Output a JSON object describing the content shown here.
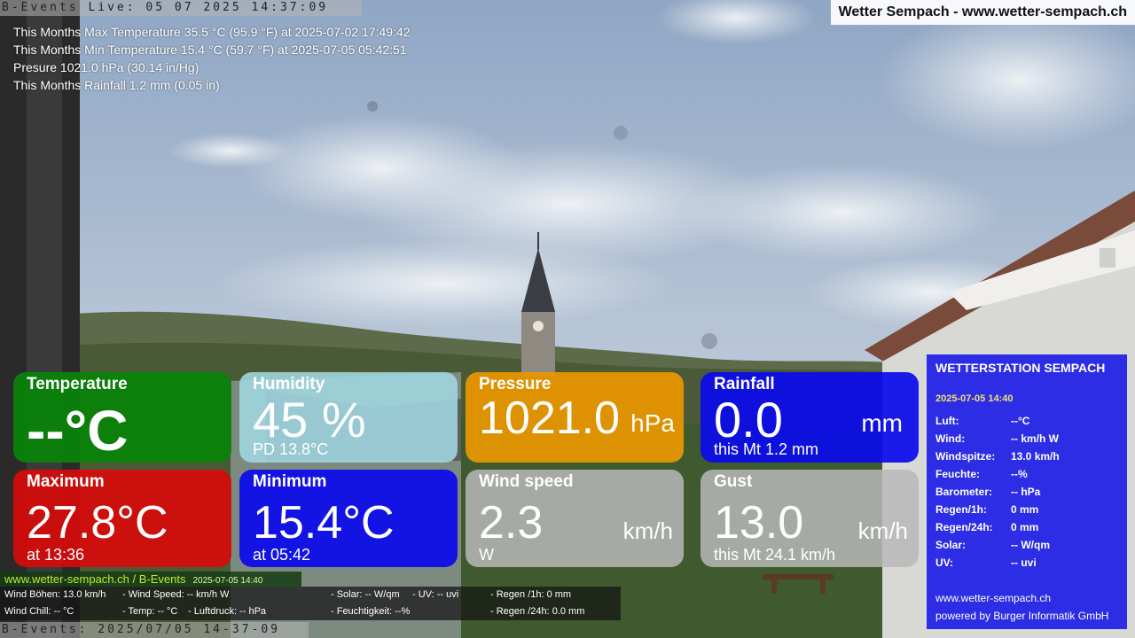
{
  "camera": {
    "top_label": "B-Events Live: 05 07 2025 14:37:09",
    "bottom_label": "B-Events: 2025/07/05 14-37-09"
  },
  "site_title": "Wetter Sempach - www.wetter-sempach.ch",
  "stats": [
    "This Months Max Temperature 35.5 °C (95.9 °F) at 2025-07-02 17:49:42",
    "This Months Min Temperature 15.4 °C (59.7 °F) at 2025-07-05 05:42:51",
    "Presure 1021.0 hPa (30.14 in/Hg)",
    "This Months Rainfall 1.2 mm (0.05 in)"
  ],
  "tiles": {
    "temperature": {
      "title": "Temperature",
      "value": "--°C",
      "color": "#0a820a"
    },
    "humidity": {
      "title": "Humidity",
      "value": "45 %",
      "sub": "PD 13.8°C",
      "color": "#a0d7e1"
    },
    "pressure": {
      "title": "Pressure",
      "value": "1021.0",
      "unit": "hPa",
      "color": "#e69600"
    },
    "rainfall": {
      "title": "Rainfall",
      "value": "0.0",
      "unit": "mm",
      "sub": "this Mt 1.2 mm",
      "color": "#0a0aeb"
    },
    "maximum": {
      "title": "Maximum",
      "value": "27.8°C",
      "sub": "at 13:36",
      "color": "#d70a0a"
    },
    "minimum": {
      "title": "Minimum",
      "value": "15.4°C",
      "sub": "at 05:42",
      "color": "#0a0aeb"
    },
    "wind": {
      "title": "Wind speed",
      "value": "2.3",
      "unit": "km/h",
      "sub": "W",
      "color": "#b9b9b9"
    },
    "gust": {
      "title": "Gust",
      "value": "13.0",
      "unit": "km/h",
      "sub": "this Mt 24.1 km/h",
      "color": "#b9b9b9"
    }
  },
  "station": {
    "title": "WETTERSTATION SEMPACH",
    "date": "2025-07-05 14:40",
    "rows": [
      {
        "k": "Luft:",
        "v": "--°C"
      },
      {
        "k": "Wind:",
        "v": "-- km/h  W"
      },
      {
        "k": "Windspitze:",
        "v": "13.0 km/h"
      },
      {
        "k": "Feuchte:",
        "v": "--%"
      },
      {
        "k": "Barometer:",
        "v": "-- hPa"
      },
      {
        "k": "Regen/1h:",
        "v": "0 mm"
      },
      {
        "k": "Regen/24h:",
        "v": "0 mm"
      },
      {
        "k": "Solar:",
        "v": "-- W/qm"
      },
      {
        "k": "UV:",
        "v": "-- uvi"
      }
    ],
    "footer_url": "www.wetter-sempach.ch",
    "footer_powered": "powered by Burger Informatik GmbH"
  },
  "ticker": {
    "site": "www.wetter-sempach.ch / B-Events",
    "date": "2025-07-05 14:40",
    "line1": [
      "Wind Böhen: 13.0 km/h",
      "- Wind Speed: -- km/h W",
      "- Solar: -- W/qm",
      "- UV: -- uvi",
      "- Regen /1h:   0 mm"
    ],
    "line2": [
      "Wind Chill: -- °C",
      "- Temp: -- °C",
      "- Luftdruck: -- hPa",
      "- Feuchtigkeit: --%",
      "- Regen /24h: 0.0 mm"
    ]
  }
}
